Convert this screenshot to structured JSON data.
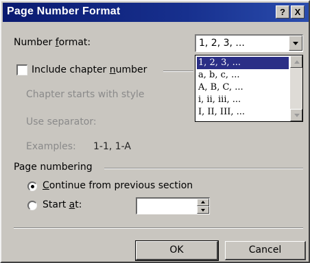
{
  "window": {
    "title": "Page Number Format",
    "help_button": "?",
    "close_button": "X"
  },
  "number_format": {
    "label_pre": "Number ",
    "label_accel": "f",
    "label_post": "ormat:",
    "selected_value": "1, 2, 3, ...",
    "options": [
      "1, 2, 3, ...",
      "a, b, c, ...",
      "A, B, C, ...",
      "i, ii, iii, ...",
      "I, II, III, ..."
    ]
  },
  "chapter": {
    "checkbox_pre": "Include chapter ",
    "checkbox_accel": "n",
    "checkbox_post": "umber",
    "checked": false,
    "starts_with_style_label": "Chapter starts with style",
    "separator_label": "Use separator:",
    "examples_label": "Examples:",
    "examples_value": "1-1, 1-A"
  },
  "page_numbering": {
    "group_label": "Page numbering",
    "continue_accel": "C",
    "continue_rest": "ontinue from previous section",
    "continue_selected": true,
    "start_at_pre": "Start ",
    "start_at_accel": "a",
    "start_at_post": "t:",
    "start_at_value": ""
  },
  "buttons": {
    "ok": "OK",
    "cancel": "Cancel"
  },
  "colors": {
    "titlebar": "#17308e",
    "dialog_face": "#c9c6c0",
    "selection": "#2b2f86"
  }
}
